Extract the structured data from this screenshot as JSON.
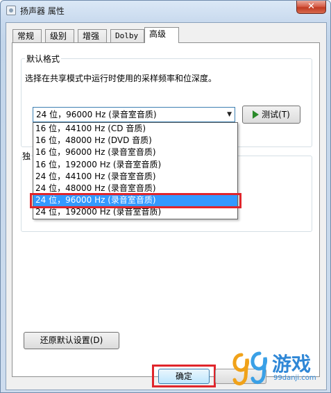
{
  "window": {
    "title": "扬声器 属性",
    "close_glyph": "✕"
  },
  "tabs": [
    {
      "label": "常规"
    },
    {
      "label": "级别"
    },
    {
      "label": "增强"
    },
    {
      "label": "Dolby"
    },
    {
      "label": "高级",
      "active": true
    }
  ],
  "default_format": {
    "group_label": "默认格式",
    "description": "选择在共享模式中运行时使用的采样频率和位深度。",
    "selected_value": "24 位，96000 Hz (录音室音质)",
    "test_button": "测试(T)",
    "options": [
      "16 位，44100 Hz (CD 音质)",
      "16 位，48000 Hz (DVD 音质)",
      "16 位，96000 Hz (录音室音质)",
      "16 位，192000 Hz (录音室音质)",
      "24 位，44100 Hz (录音室音质)",
      "24 位，48000 Hz (录音室音质)",
      "24 位，96000 Hz (录音室音质)",
      "24 位，192000 Hz (录音室音质)"
    ],
    "selected_index": 6
  },
  "exclusive_mode": {
    "label_fragment": "独"
  },
  "restore_button": "还原默认设置(D)",
  "ok_button": "确定",
  "watermark": {
    "text": "游戏",
    "url": "99danji.com"
  },
  "colors": {
    "highlight": "#e0252b",
    "selection": "#3399ff",
    "title_bar": "#c9daee"
  }
}
